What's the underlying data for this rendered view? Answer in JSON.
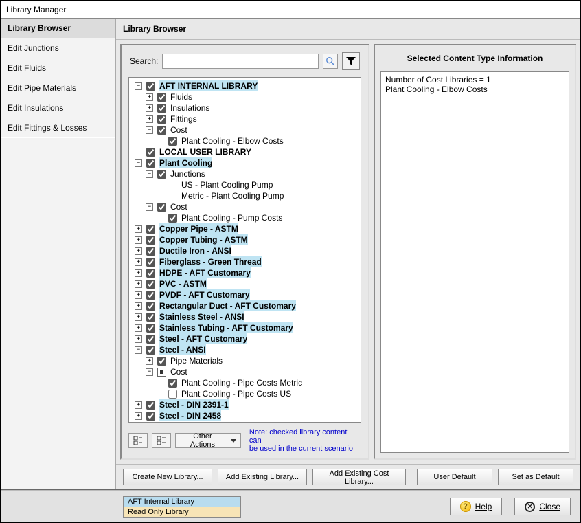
{
  "window": {
    "title": "Library Manager"
  },
  "sidebar": {
    "items": [
      {
        "label": "Library Browser",
        "selected": true
      },
      {
        "label": "Edit Junctions"
      },
      {
        "label": "Edit Fluids"
      },
      {
        "label": "Edit Pipe Materials"
      },
      {
        "label": "Edit Insulations"
      },
      {
        "label": "Edit Fittings & Losses"
      }
    ]
  },
  "main": {
    "header": "Library Browser",
    "search": {
      "label": "Search:",
      "placeholder": "",
      "value": ""
    },
    "icons": {
      "search": "search-icon",
      "filter": "filter-icon"
    }
  },
  "tree": [
    {
      "label": "AFT INTERNAL LIBRARY",
      "bold": true,
      "hl": true,
      "exp": "minus",
      "chk": true,
      "children": [
        {
          "label": "Fluids",
          "exp": "plus",
          "chk": true
        },
        {
          "label": "Insulations",
          "exp": "plus",
          "chk": true
        },
        {
          "label": "Fittings",
          "exp": "plus",
          "chk": true
        },
        {
          "label": "Cost",
          "exp": "minus",
          "chk": true,
          "children": [
            {
              "label": "Plant Cooling - Elbow Costs",
              "exp": "none",
              "chk": true
            }
          ]
        }
      ]
    },
    {
      "label": "LOCAL USER LIBRARY",
      "bold": true,
      "exp": "none",
      "chk": true
    },
    {
      "label": "Plant Cooling",
      "bold": true,
      "hl": true,
      "exp": "minus",
      "chk": true,
      "children": [
        {
          "label": "Junctions",
          "exp": "minus",
          "chk": true,
          "children": [
            {
              "label": "US - Plant Cooling Pump",
              "exp": "none",
              "chk": "none"
            },
            {
              "label": "Metric - Plant Cooling Pump",
              "exp": "none",
              "chk": "none"
            }
          ]
        },
        {
          "label": "Cost",
          "exp": "minus",
          "chk": true,
          "children": [
            {
              "label": "Plant Cooling - Pump Costs",
              "exp": "none",
              "chk": true
            }
          ]
        }
      ]
    },
    {
      "label": "Copper Pipe - ASTM",
      "bold": true,
      "hl": true,
      "exp": "plus",
      "chk": true
    },
    {
      "label": "Copper Tubing - ASTM",
      "bold": true,
      "hl": true,
      "exp": "plus",
      "chk": true
    },
    {
      "label": "Ductile Iron - ANSI",
      "bold": true,
      "hl": true,
      "exp": "plus",
      "chk": true
    },
    {
      "label": "Fiberglass - Green Thread",
      "bold": true,
      "hl": true,
      "exp": "plus",
      "chk": true
    },
    {
      "label": "HDPE - AFT Customary",
      "bold": true,
      "hl": true,
      "exp": "plus",
      "chk": true
    },
    {
      "label": "PVC - ASTM",
      "bold": true,
      "hl": true,
      "exp": "plus",
      "chk": true
    },
    {
      "label": "PVDF - AFT Customary",
      "bold": true,
      "hl": true,
      "exp": "plus",
      "chk": true
    },
    {
      "label": "Rectangular Duct - AFT Customary",
      "bold": true,
      "hl": true,
      "exp": "plus",
      "chk": true
    },
    {
      "label": "Stainless Steel - ANSI",
      "bold": true,
      "hl": true,
      "exp": "plus",
      "chk": true
    },
    {
      "label": "Stainless Tubing - AFT Customary",
      "bold": true,
      "hl": true,
      "exp": "plus",
      "chk": true
    },
    {
      "label": "Steel - AFT Customary",
      "bold": true,
      "hl": true,
      "exp": "plus",
      "chk": true
    },
    {
      "label": "Steel - ANSI",
      "bold": true,
      "hl": true,
      "exp": "minus",
      "chk": true,
      "children": [
        {
          "label": "Pipe Materials",
          "exp": "plus",
          "chk": true
        },
        {
          "label": "Cost",
          "exp": "minus",
          "chk": "mixed",
          "children": [
            {
              "label": "Plant Cooling - Pipe Costs Metric",
              "exp": "none",
              "chk": true
            },
            {
              "label": "Plant Cooling - Pipe Costs US",
              "exp": "none",
              "chk": false
            }
          ]
        }
      ]
    },
    {
      "label": "Steel - DIN 2391-1",
      "bold": true,
      "hl": true,
      "exp": "plus",
      "chk": true
    },
    {
      "label": "Steel - DIN 2458",
      "bold": true,
      "hl": true,
      "exp": "plus",
      "chk": true
    }
  ],
  "tree_footer": {
    "expand_all": "expand-all-icon",
    "collapse_all": "collapse-all-icon",
    "other_actions": "Other Actions",
    "note_line1": "Note: checked library content can",
    "note_line2": "be used in the current scenario"
  },
  "selected_info": {
    "header": "Selected Content Type Information",
    "lines": [
      "Number of Cost Libraries = 1",
      "Plant Cooling - Elbow Costs"
    ]
  },
  "bottom_buttons": {
    "create": "Create New Library...",
    "add_existing": "Add Existing Library...",
    "add_cost": "Add Existing Cost Library...",
    "user_default": "User Default",
    "set_default": "Set as Default"
  },
  "legend": {
    "aft": "AFT Internal Library",
    "readonly": "Read Only Library"
  },
  "footer": {
    "help": "Help",
    "close": "Close"
  },
  "colors": {
    "highlight": "#bfe4f3",
    "legend_aft": "#b8dcef",
    "legend_ro": "#f7e4b6",
    "note": "#0000cc"
  }
}
